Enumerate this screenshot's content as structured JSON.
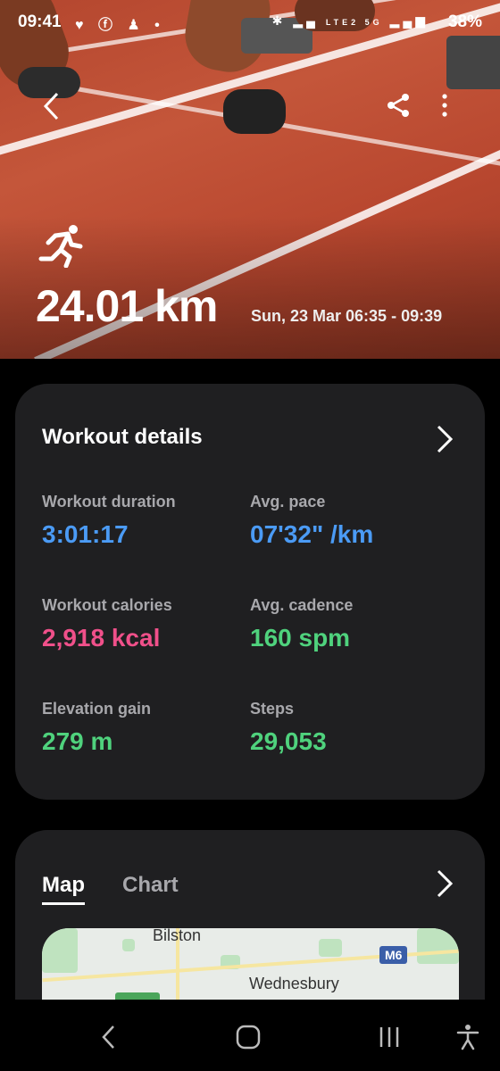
{
  "status_bar": {
    "time": "09:41",
    "battery": "38%",
    "network": "LTE2 5G"
  },
  "hero": {
    "distance": "24.01 km",
    "datetime": "Sun, 23 Mar 06:35 - 09:39",
    "activity_icon": "running-icon"
  },
  "workout_details": {
    "title": "Workout details",
    "metrics": [
      {
        "label": "Workout duration",
        "value": "3:01:17",
        "color": "#4b9bf5"
      },
      {
        "label": "Avg. pace",
        "value": "07'32\" /km",
        "color": "#4b9bf5"
      },
      {
        "label": "Workout calories",
        "value": "2,918 kcal",
        "color": "#f0508a"
      },
      {
        "label": "Avg. cadence",
        "value": "160 spm",
        "color": "#4fd27d"
      },
      {
        "label": "Elevation gain",
        "value": "279 m",
        "color": "#4fd27d"
      },
      {
        "label": "Steps",
        "value": "29,053",
        "color": "#4fd27d"
      }
    ]
  },
  "map_section": {
    "tabs": [
      {
        "label": "Map",
        "selected": true
      },
      {
        "label": "Chart",
        "selected": false
      }
    ],
    "map_labels": {
      "town1": "Bilston",
      "town2": "Wednesbury",
      "motorway": "M6"
    }
  }
}
